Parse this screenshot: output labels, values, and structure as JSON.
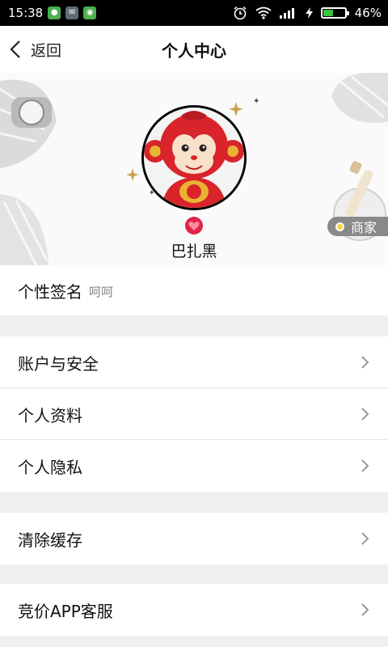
{
  "status_bar": {
    "time": "15:38",
    "battery_percent": "46%",
    "battery_level": 0.46
  },
  "nav": {
    "back_label": "返回",
    "title": "个人中心"
  },
  "profile": {
    "username": "巴扎黑",
    "merchant_label": "商家"
  },
  "signature": {
    "label": "个性签名",
    "value": "呵呵"
  },
  "menu": {
    "account_security": "账户与安全",
    "personal_info": "个人资料",
    "personal_privacy": "个人隐私",
    "clear_cache": "清除缓存",
    "customer_service": "竞价APP客服"
  },
  "colors": {
    "battery_green": "#39c43f",
    "badge_red": "#e0244a",
    "merchant_tag_bg": "#888a8a"
  }
}
